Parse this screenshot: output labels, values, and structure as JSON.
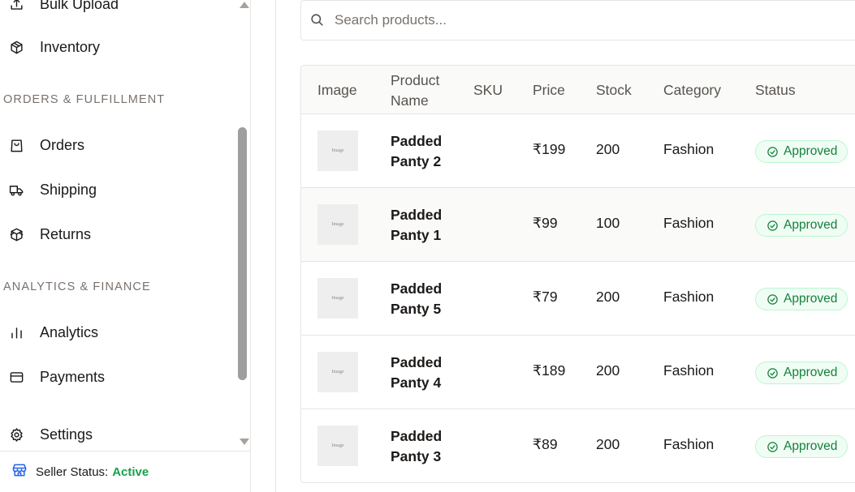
{
  "sidebar": {
    "items_top": [
      {
        "label": "Bulk Upload",
        "icon": "upload-icon"
      },
      {
        "label": "Inventory",
        "icon": "box-icon"
      }
    ],
    "section_orders": "ORDERS & FULFILLMENT",
    "items_orders": [
      {
        "label": "Orders",
        "icon": "shopping-bag-icon"
      },
      {
        "label": "Shipping",
        "icon": "truck-icon"
      },
      {
        "label": "Returns",
        "icon": "return-box-icon"
      }
    ],
    "section_analytics": "ANALYTICS & FINANCE",
    "items_analytics": [
      {
        "label": "Analytics",
        "icon": "bar-chart-icon"
      },
      {
        "label": "Payments",
        "icon": "credit-card-icon"
      }
    ],
    "settings_label": "Settings",
    "seller_status_label": "Seller Status:",
    "seller_status_value": "Active"
  },
  "search": {
    "placeholder": "Search products..."
  },
  "table": {
    "headers": {
      "image": "Image",
      "name_line1": "Product",
      "name_line2": "Name",
      "sku": "SKU",
      "price": "Price",
      "stock": "Stock",
      "category": "Category",
      "status": "Status"
    },
    "image_placeholder": "Image",
    "rows": [
      {
        "name_line1": "Padded",
        "name_line2": "Panty 2",
        "sku": "",
        "price": "₹199",
        "stock": "200",
        "category": "Fashion",
        "status": "Approved"
      },
      {
        "name_line1": "Padded",
        "name_line2": "Panty 1",
        "sku": "",
        "price": "₹99",
        "stock": "100",
        "category": "Fashion",
        "status": "Approved"
      },
      {
        "name_line1": "Padded",
        "name_line2": "Panty 5",
        "sku": "",
        "price": "₹79",
        "stock": "200",
        "category": "Fashion",
        "status": "Approved"
      },
      {
        "name_line1": "Padded",
        "name_line2": "Panty 4",
        "sku": "",
        "price": "₹189",
        "stock": "200",
        "category": "Fashion",
        "status": "Approved"
      },
      {
        "name_line1": "Padded",
        "name_line2": "Panty 3",
        "sku": "",
        "price": "₹89",
        "stock": "200",
        "category": "Fashion",
        "status": "Approved"
      }
    ]
  },
  "colors": {
    "accent_blue": "#2563eb",
    "status_green": "#16a34a",
    "badge_bg": "#f0fdf4",
    "badge_border": "#bbf7d0"
  }
}
